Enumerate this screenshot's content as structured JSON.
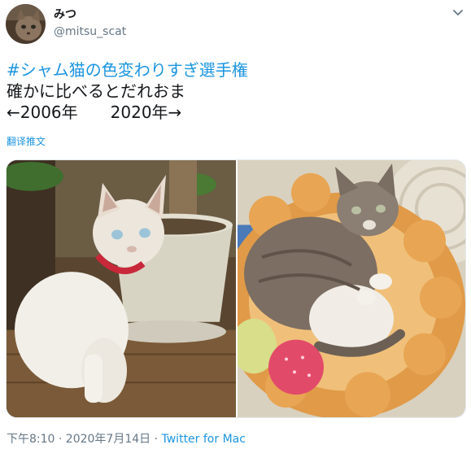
{
  "author": {
    "display_name": "みつ",
    "handle": "@mitsu_scat",
    "avatar_icon": "cat-avatar-icon"
  },
  "menu_icon": "chevron-down-icon",
  "tweet": {
    "hashtag": "#シャム猫の色変わりすぎ選手権",
    "line1": "確かに比べるとだれおま",
    "line2": "←2006年　　2020年→",
    "translate_label": "翻译推文"
  },
  "media": {
    "photos": [
      {
        "subject": "white-siamese-kitten-photo"
      },
      {
        "subject": "grey-tabby-cat-in-bed-photo"
      }
    ]
  },
  "footer": {
    "timestamp": "下午8:10 · 2020年7月14日",
    "separator": " · ",
    "source": "Twitter for Mac"
  },
  "colors": {
    "link": "#1b95e0",
    "secondary": "#657786",
    "primary": "#14171a"
  }
}
